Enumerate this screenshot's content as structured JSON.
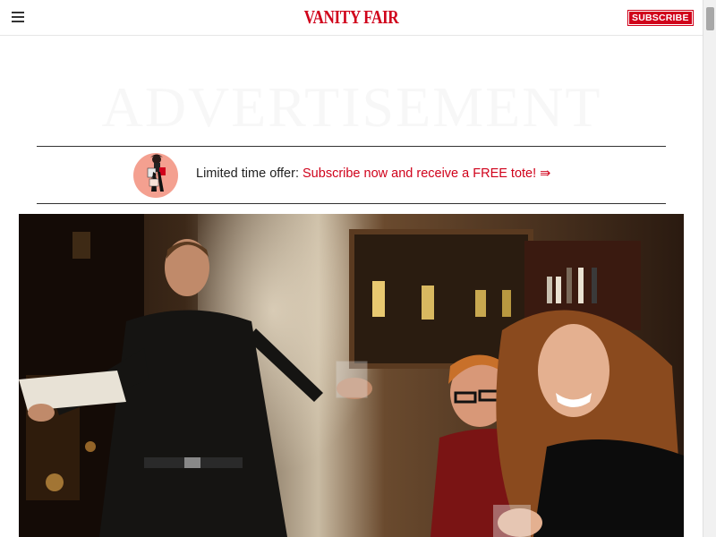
{
  "header": {
    "logo": "VANITY FAIR",
    "subscribe_label": "SUBSCRIBE",
    "menu_icon": "hamburger-icon"
  },
  "ad": {
    "ghost_text": "ADVERTISEMENT"
  },
  "offer": {
    "prefix": "Limited time offer:",
    "link_text": "Subscribe now and receive a FREE tote! ⇛",
    "image_icon": "tote-offer-illustration"
  },
  "hero": {
    "image": "photo-party-man-speaking-woman-laughing"
  },
  "colors": {
    "brand_red": "#d0021b",
    "rule": "#333333"
  }
}
